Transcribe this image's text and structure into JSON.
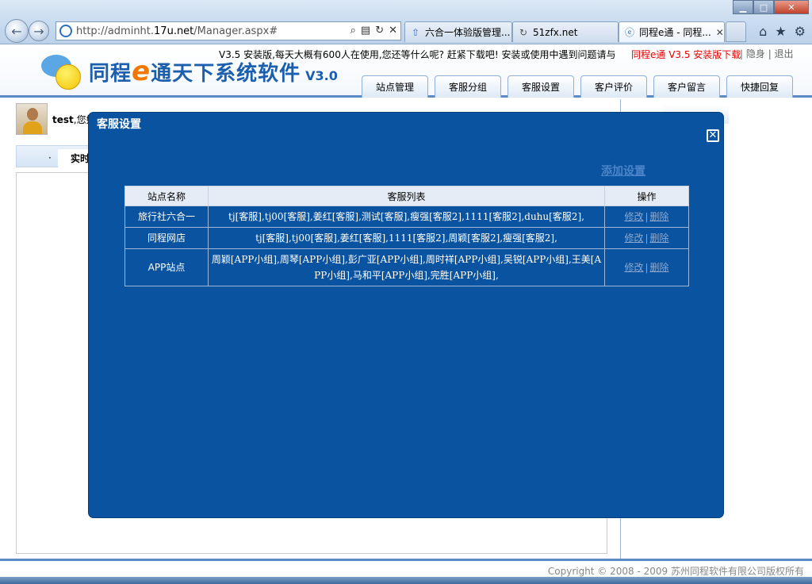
{
  "browser": {
    "url_prefix": "http://adminht.",
    "url_domain": "17u.net",
    "url_suffix": "/Manager.aspx#",
    "tabs": [
      {
        "label": "六合一体验版管理..."
      },
      {
        "label": "51zfx.net"
      },
      {
        "label": "同程e通 - 同程..."
      }
    ]
  },
  "header": {
    "logo_prefix": "同程",
    "logo_e": "e",
    "logo_suffix": "通天下系统软件",
    "version": "V3.0",
    "notice": "V3.5 安装版,每天大概有600人在使用,您还等什么呢? 赶紧下载吧! 安装或使用中遇到问题请与客",
    "download_link": "同程e通 V3.5 安装版下载",
    "hide_link": "隐身",
    "exit_link": "退出",
    "menu": [
      {
        "label": "站点管理"
      },
      {
        "label": "客服分组"
      },
      {
        "label": "客服设置"
      },
      {
        "label": "客户评价"
      },
      {
        "label": "客户留言"
      },
      {
        "label": "快捷回复"
      }
    ]
  },
  "main": {
    "greeting_user": "test",
    "greeting_rest": ",您好",
    "tab_live": "实时"
  },
  "modal": {
    "title": "客服设置",
    "add_link": "添加设置",
    "columns": [
      "站点名称",
      "客服列表",
      "操作"
    ],
    "rows": [
      {
        "site": "旅行社六合一",
        "agents": "tj[客服],tj00[客服],姜红[客服],测试[客服],瘦强[客服2],1111[客服2],duhu[客服2],",
        "edit": "修改",
        "delete": "删除"
      },
      {
        "site": "同程网店",
        "agents": "tj[客服],tj00[客服],姜红[客服],1111[客服2],周颖[客服2],瘦强[客服2],",
        "edit": "修改",
        "delete": "删除"
      },
      {
        "site": "APP站点",
        "agents": "周颖[APP小组],周琴[APP小组],彭广亚[APP小组],周时祥[APP小组],吴锐[APP小组],王美[APP小组],马和平[APP小组],完胜[APP小组],",
        "edit": "修改",
        "delete": "删除"
      }
    ]
  },
  "footer": {
    "copyright": "Copyright © 2008 - 2009 苏州同程软件有限公司版权所有"
  }
}
